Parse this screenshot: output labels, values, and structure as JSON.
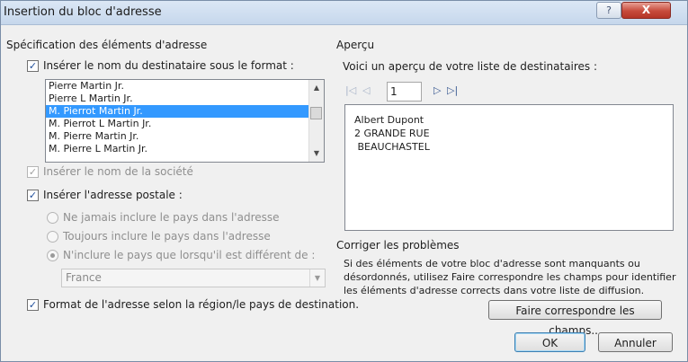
{
  "window": {
    "title": "Insertion du bloc d'adresse",
    "help_label": "?",
    "close_label": "X"
  },
  "left": {
    "group_title": "Spécification des éléments d'adresse",
    "insert_recipient_name": {
      "label": "Insérer le nom du destinataire sous le format :",
      "checked": true
    },
    "name_formats": [
      "Pierre Martin Jr.",
      "Pierre L Martin Jr.",
      "M. Pierrot Martin Jr.",
      "M. Pierrot L Martin Jr.",
      "M. Pierre Martin Jr.",
      "M. Pierre L Martin Jr."
    ],
    "selected_format_index": 2,
    "insert_company": {
      "label": "Insérer le nom de la société",
      "checked": true,
      "enabled": false
    },
    "insert_postal": {
      "label": "Insérer l'adresse postale :",
      "checked": true
    },
    "country_options": [
      {
        "label": "Ne jamais inclure le pays dans l'adresse",
        "selected": false
      },
      {
        "label": "Toujours inclure le pays dans l'adresse",
        "selected": false
      },
      {
        "label": "N'inclure le pays que lorsqu'il est différent de :",
        "selected": true
      }
    ],
    "country_value": "France",
    "format_by_region": {
      "label": "Format de l'adresse selon la région/le pays de destination.",
      "checked": true
    }
  },
  "right": {
    "preview_title": "Aperçu",
    "preview_caption": "Voici un aperçu de votre liste de destinataires :",
    "record_number": "1",
    "preview_lines": [
      "Albert Dupont",
      "2 GRANDE RUE",
      " BEAUCHASTEL"
    ],
    "fix_title": "Corriger les problèmes",
    "fix_text_lines": [
      "Si des éléments de votre bloc d'adresse sont manquants ou",
      "désordonnés, utilisez Faire correspondre les champs pour identifier",
      "les éléments d'adresse corrects dans votre liste de diffusion."
    ],
    "match_fields_label": "Faire correspondre les champs..."
  },
  "footer": {
    "ok_label": "OK",
    "cancel_label": "Annuler"
  }
}
